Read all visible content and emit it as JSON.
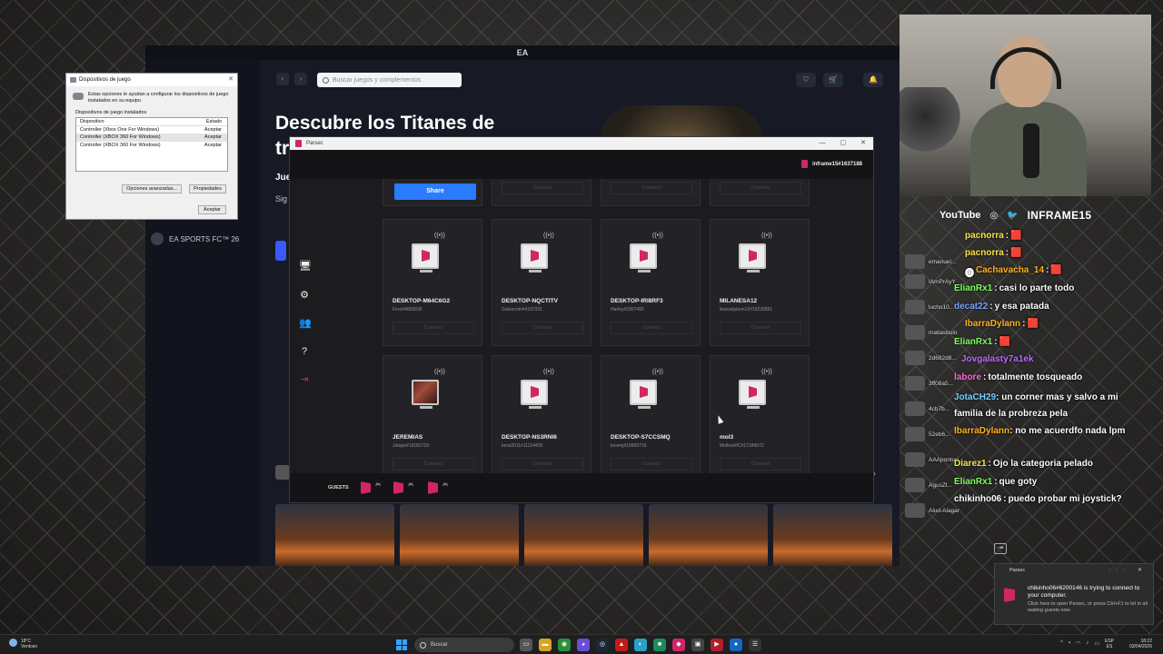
{
  "ea": {
    "window_title": "EA",
    "search_placeholder": "Buscar juegos y complementos",
    "hero_title_line1": "Descubre los Titanes de",
    "hero_title_line2": "tr",
    "hero_subtitle": "Jue",
    "hero_text": "Sig mie",
    "sidebar_game": "EA SPORTS FC™ 26",
    "nav_back": "‹",
    "nav_forward": "›",
    "buttons": {
      "wishlist": "♡",
      "cart": "🛒",
      "notifications": "🔔"
    },
    "carousel_next": "›"
  },
  "dialog": {
    "title": "Dispositivos de juego",
    "close": "✕",
    "description": "Estas opciones le ayudan a configurar los dispositivos de juego instalados en su equipo.",
    "list_label": "Dispositivos de juego instalados",
    "columns": [
      "Dispositivo",
      "Estado"
    ],
    "rows": [
      {
        "device": "Controller (Xbox One For Windows)",
        "status": "Aceptar"
      },
      {
        "device": "Controller (XBOX 360 For Windows)",
        "status": "Aceptar"
      },
      {
        "device": "Controller (XBOX 360 For Windows)",
        "status": "Aceptar"
      }
    ],
    "advanced_button": "Opciones avanzadas...",
    "properties_button": "Propiedades",
    "ok_button": "Aceptar"
  },
  "parsec": {
    "window_title": "Parsec",
    "window_controls": {
      "minimize": "—",
      "maximize": "▢",
      "close": "✕"
    },
    "user": "inframe15#1637188",
    "share_button": "Share",
    "connect_label": "Connect",
    "guests_label": "GUESTS",
    "rail_icons": [
      "monitor-icon",
      "gear-icon",
      "friends-icon",
      "help-icon",
      "signout-icon"
    ],
    "computers": [
      {
        "name": "DESKTOP-M64C6G2",
        "id": "Fero#4893836"
      },
      {
        "name": "DESKTOP-NQCTITV",
        "id": "Gatoscrim#4197331"
      },
      {
        "name": "DESKTOP-IRI8RF3",
        "id": "Harley#3307492"
      },
      {
        "name": "MILANESA12",
        "id": "ibarradylann12#19226891"
      },
      {
        "name": "JEREMIAS",
        "id": "Jotape#19181719"
      },
      {
        "name": "DESKTOP-NS3RNI6",
        "id": "kevz2011#11124425"
      },
      {
        "name": "DESKTOP-S7CCSMQ",
        "id": "leosmj#15855716"
      },
      {
        "name": "mol3",
        "id": "MoltresRC#17349672"
      }
    ]
  },
  "stream": {
    "socials": {
      "youtube": "YouTube",
      "instagram": "◎",
      "twitter": "🐦",
      "handle": "INFRAME15"
    },
    "viewers": [
      "emanuel...",
      "IAmPrAyY",
      "lucho10...",
      "matiasbulo",
      "2d682d8...",
      "3ff08a5...",
      "4cb7b...",
      "52eb6...",
      "AAAponton...",
      "AgusZt...",
      "Alud-Alagar"
    ],
    "chat": [
      {
        "user": "pacnorra",
        "text": "🟥",
        "color": "#f7e64a"
      },
      {
        "user": "pacnorra",
        "text": "🟥",
        "color": "#f7e64a"
      },
      {
        "user": "Cachavacha_14",
        "text": "🟥",
        "color": "#ffb020"
      },
      {
        "user": "ElianRx1",
        "text": "casi lo parte todo",
        "color": "#7bff5a"
      },
      {
        "user": "decat22",
        "text": "y esa patada",
        "color": "#7aa2ff"
      },
      {
        "user": "IbarraDylann",
        "text": "🟥",
        "color": "#ffb020"
      },
      {
        "user": "ElianRx1",
        "text": "🟥",
        "color": "#7bff5a"
      },
      {
        "user": "Jovgalasty7a1ek",
        "text": "",
        "color": "#b96cff"
      },
      {
        "user": "labore",
        "text": "totalmente tosqueado",
        "color": "#ff6ad5"
      },
      {
        "user": "JotaCH29",
        "text": "un corner mas y salvo a mi familia de la probreza pela",
        "color": "#6fd3ff"
      },
      {
        "user": "IbarraDylann",
        "text": "no me acuerdfo nada lpm",
        "color": "#ffb020"
      },
      {
        "user": "Diarez1",
        "text": "Ojo la categoria pelado",
        "color": "#f7e64a"
      },
      {
        "user": "ElianRx1",
        "text": "que goty",
        "color": "#7bff5a"
      },
      {
        "user": "chikinho06",
        "text": "puedo probar mi joystick?",
        "color": "#ffffff"
      }
    ]
  },
  "toast": {
    "app": "Parsec",
    "controls": "··· ✕",
    "message": "chikinho06#6200146 is trying to connect to your computer.",
    "hint": "Click here to open Parsec, or press Ctrl+F1 to let in all waiting guests now."
  },
  "taskbar": {
    "weather_temp": "18°C",
    "weather_desc": "Ventoso",
    "search": "Buscar",
    "lang_line1": "ESP",
    "lang_line2": "ES",
    "time": "18:22",
    "date": "03/04/2026"
  }
}
